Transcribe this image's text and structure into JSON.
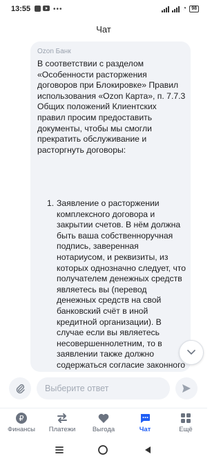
{
  "status": {
    "time": "13:55",
    "battery": "98"
  },
  "header": {
    "title": "Чат"
  },
  "message": {
    "sender": "Ozon Банк",
    "text": "В соответствии с разделом «Особенности расторжения договоров при Блокировке» Правил использования «Ozon Карта», п. 7.7.3 Общих положений Клиентских правил просим предоставить документы, чтобы мы смогли прекратить обслуживание и расторгнуть договоры:",
    "list": [
      {
        "number": "1.",
        "text": "Заявление о расторжении комплексного договора и закрытии счетов. В нём должна быть ваша собственноручная подпись, заверенная нотариусом, и реквизиты, из которых однозначно следует, что получателем денежных средств являетесь вы (перевод денежных средств на свой банковский счёт в иной кредитной организации). В случае если вы являетесь несовершеннолетним, то в заявлении также должно содержаться согласие законного представителя (родителя, усыновителя или попечителя) на закрытие счета, подтверждённое собственноручной подписью"
      }
    ]
  },
  "input": {
    "placeholder": "Выберите ответ"
  },
  "nav": {
    "items": [
      {
        "label": "Финансы",
        "icon": "ruble-coin-icon"
      },
      {
        "label": "Платежи",
        "icon": "transfer-arrows-icon"
      },
      {
        "label": "Выгода",
        "icon": "heart-icon"
      },
      {
        "label": "Чат",
        "icon": "chat-bubble-icon",
        "active": true
      },
      {
        "label": "Ещё",
        "icon": "grid-icon"
      }
    ]
  },
  "colors": {
    "accent": "#1f5ef5",
    "bubble": "#f1f3f7",
    "muted": "#9aa2ae"
  }
}
